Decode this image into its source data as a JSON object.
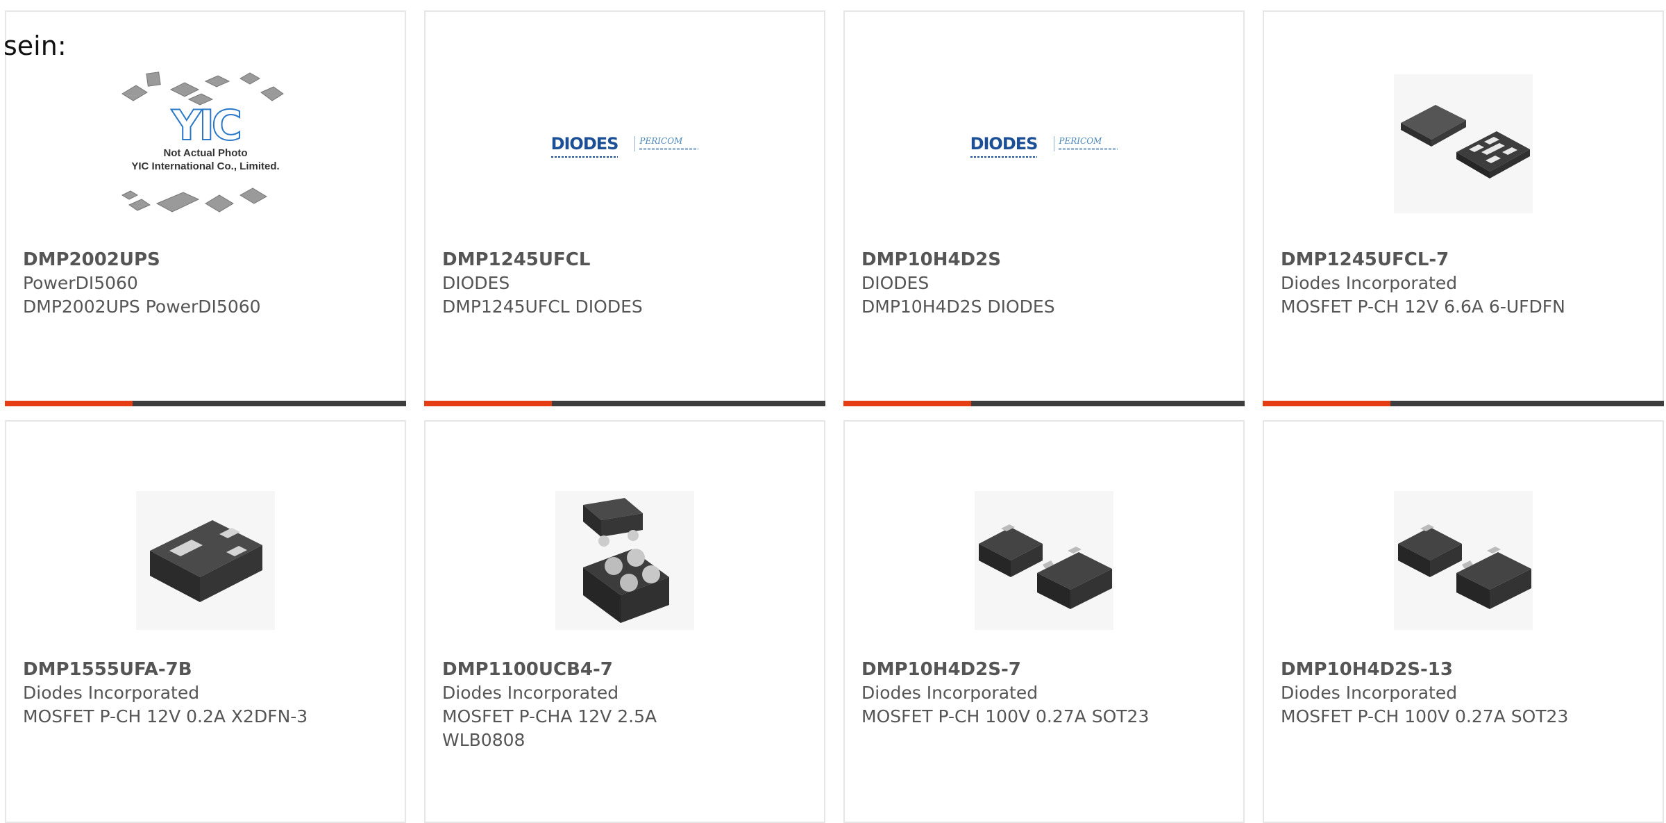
{
  "overlay_text": "sein:",
  "products": [
    {
      "part": "DMP2002UPS",
      "manufacturer": "PowerDI5060",
      "description": "DMP2002UPS PowerDI5060",
      "image": "yic-placeholder",
      "placeholder": {
        "logo": "YIC",
        "line1": "Not Actual Photo",
        "line2": "YIC International Co., Limited."
      }
    },
    {
      "part": "DMP1245UFCL",
      "manufacturer": "DIODES",
      "description": "DMP1245UFCL DIODES",
      "image": "diodes-logo",
      "logo": {
        "brand": "DIODES",
        "partner": "PERICOM"
      }
    },
    {
      "part": "DMP10H4D2S",
      "manufacturer": "DIODES",
      "description": "DMP10H4D2S DIODES",
      "image": "diodes-logo",
      "logo": {
        "brand": "DIODES",
        "partner": "PERICOM"
      }
    },
    {
      "part": "DMP1245UFCL-7",
      "manufacturer": "Diodes Incorporated",
      "description": "MOSFET P-CH 12V 6.6A 6-UFDFN",
      "image": "ufdfn-package"
    },
    {
      "part": "DMP1555UFA-7B",
      "manufacturer": "Diodes Incorporated",
      "description": "MOSFET P-CH 12V 0.2A X2DFN-3",
      "image": "x2dfn-package"
    },
    {
      "part": "DMP1100UCB4-7",
      "manufacturer": "Diodes Incorporated",
      "description": "MOSFET P-CHA 12V 2.5A WLB0808",
      "image": "wlb-package"
    },
    {
      "part": "DMP10H4D2S-7",
      "manufacturer": "Diodes Incorporated",
      "description": "MOSFET P-CH 100V 0.27A SOT23",
      "image": "sot23-package"
    },
    {
      "part": "DMP10H4D2S-13",
      "manufacturer": "Diodes Incorporated",
      "description": "MOSFET P-CH 100V 0.27A SOT23",
      "image": "sot23-package"
    }
  ],
  "colors": {
    "accent": "#e63e14",
    "bar": "#3d3d3d",
    "border": "#e6e6e6",
    "text": "#555555",
    "diodes_blue": "#1c4f96"
  }
}
